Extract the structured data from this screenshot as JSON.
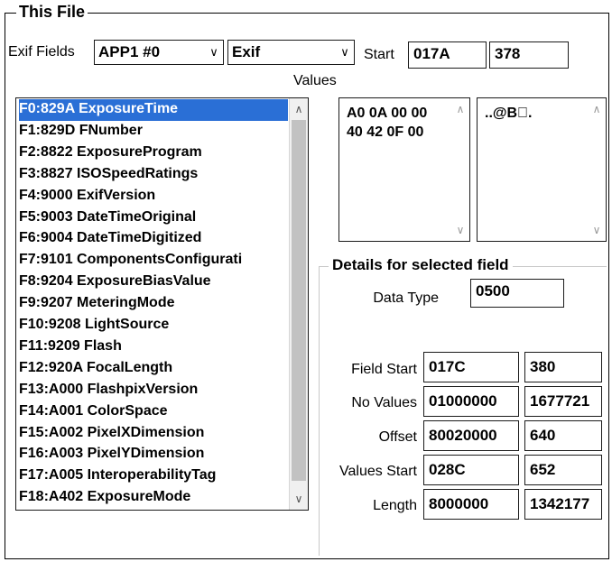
{
  "group_title": "This File",
  "exif_fields": {
    "label": "Exif Fields",
    "segment_value": "APP1 #0",
    "type_value": "Exif",
    "start_label": "Start",
    "start_hex": "017A",
    "start_dec": "378"
  },
  "values_label": "Values",
  "field_list": [
    "F0:829A ExposureTime",
    "F1:829D FNumber",
    "F2:8822 ExposureProgram",
    "F3:8827 ISOSpeedRatings",
    "F4:9000 ExifVersion",
    "F5:9003 DateTimeOriginal",
    "F6:9004 DateTimeDigitized",
    "F7:9101 ComponentsConfigurati",
    "F8:9204 ExposureBiasValue",
    "F9:9207 MeteringMode",
    "F10:9208 LightSource",
    "F11:9209 Flash",
    "F12:920A FocalLength",
    "F13:A000 FlashpixVersion",
    "F14:A001 ColorSpace",
    "F15:A002 PixelXDimension",
    "F16:A003 PixelYDimension",
    "F17:A005 InteroperabilityTag",
    "F18:A402 ExposureMode"
  ],
  "values_hex": "A0 0A 00 00\n40 42 0F 00",
  "values_ascii": "..@B\u0000.",
  "details": {
    "title": "Details for selected field",
    "data_type_label": "Data Type",
    "data_type_value": "0500",
    "field_start_label": "Field Start",
    "field_start_hex": "017C",
    "field_start_dec": "380",
    "no_values_label": "No Values",
    "no_values_hex": "01000000",
    "no_values_dec": "1677721",
    "offset_label": "Offset",
    "offset_hex": "80020000",
    "offset_dec": "640",
    "values_start_label": "Values Start",
    "values_start_hex": "028C",
    "values_start_dec": "652",
    "length_label": "Length",
    "length_hex": "8000000",
    "length_dec": "1342177"
  },
  "icons": {
    "dropdown": "chevron-down-icon",
    "scroll_up": "scroll-up-icon",
    "scroll_down": "scroll-down-icon"
  },
  "colors": {
    "selection": "#2a6fd6",
    "scroll_thumb": "#c2c2c2"
  }
}
